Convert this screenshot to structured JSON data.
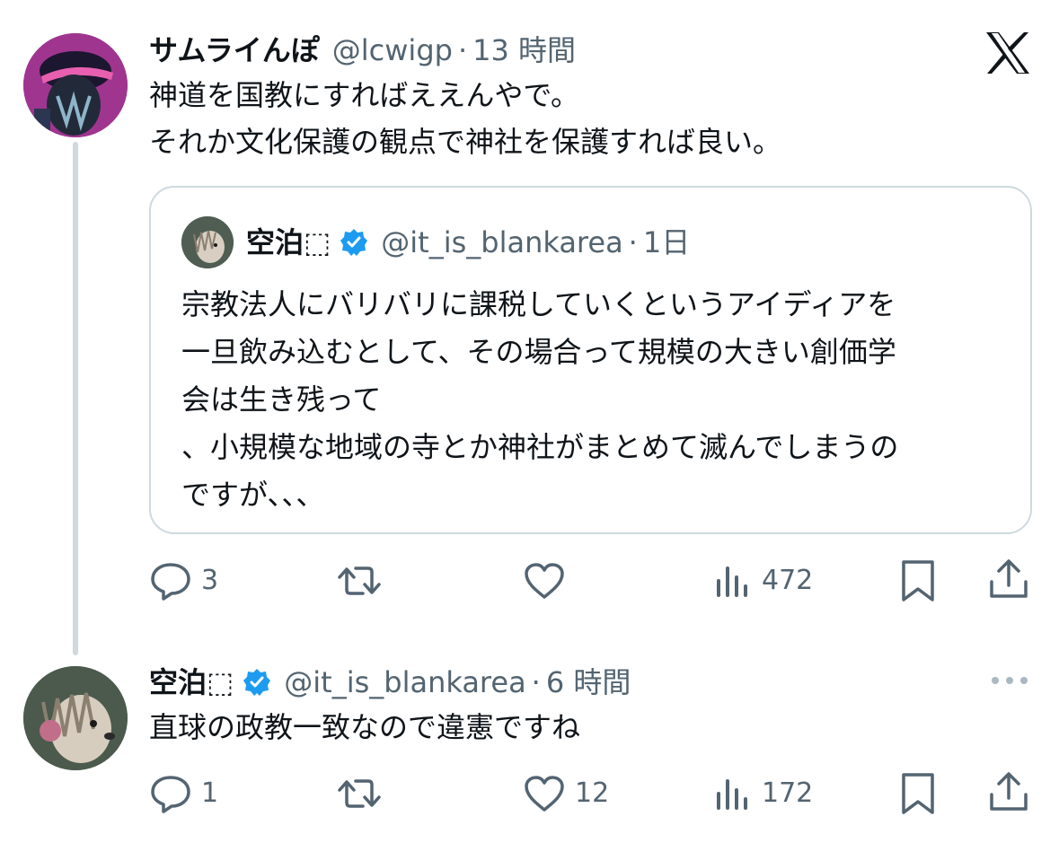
{
  "app": {
    "logo_icon": "x-logo-icon"
  },
  "colors": {
    "text": "#0f1419",
    "secondary": "#536471",
    "thread_line": "#cfd9de",
    "card_border": "#cfd9de",
    "verified": "#1d9bf0"
  },
  "tweets": [
    {
      "name": "サムライんぽ",
      "handle": "@lcwigp",
      "separator": "·",
      "time": "13 時間",
      "text_lines": [
        "神道を国教にすればええんやで。",
        "それか文化保護の観点で神社を保護すれば良い。"
      ],
      "quote": {
        "name": "空泊⬚",
        "handle": "@it_is_blankarea",
        "separator": "·",
        "time": "1日",
        "verified": true,
        "text_lines": [
          "宗教法人にバリバリに課税していくというアイディアを",
          "一旦飲み込むとして、その場合って規模の大きい創価学",
          "会は生き残って",
          "、小規模な地域の寺とか神社がまとめて滅んでしまうの",
          "ですが、、、"
        ]
      },
      "actions": {
        "reply_count": "3",
        "retweet_count": "",
        "like_count": "",
        "views_count": "472"
      }
    },
    {
      "name": "空泊⬚",
      "handle": "@it_is_blankarea",
      "separator": "·",
      "time": "6 時間",
      "verified": true,
      "text_lines": [
        "直球の政教一致なので違憲ですね"
      ],
      "actions": {
        "reply_count": "1",
        "retweet_count": "",
        "like_count": "12",
        "views_count": "172"
      }
    }
  ]
}
